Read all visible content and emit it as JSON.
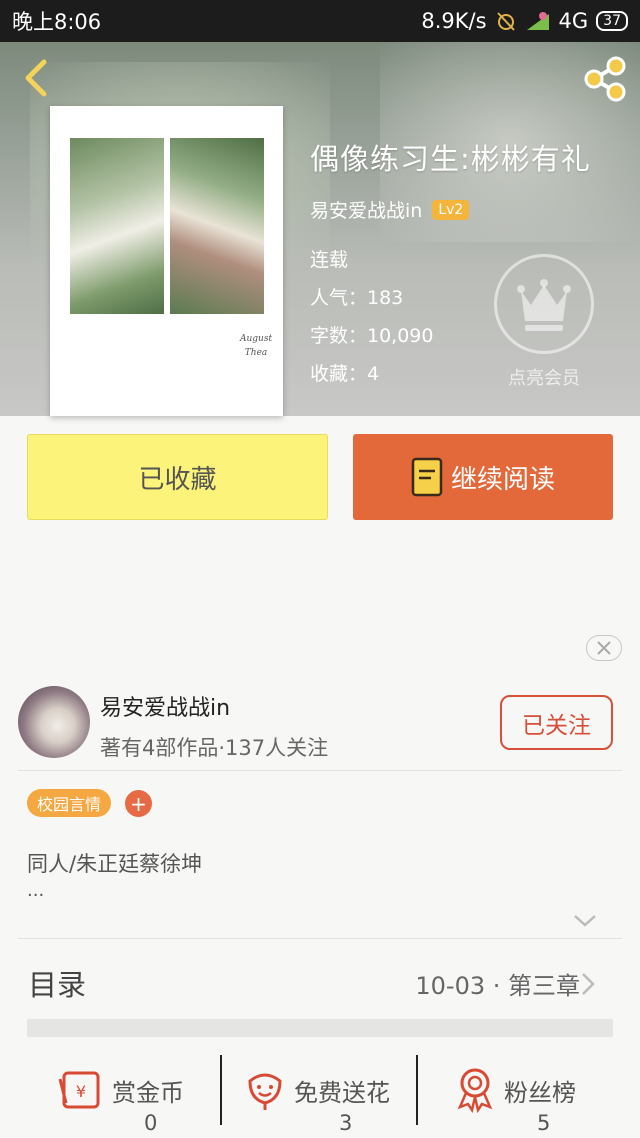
{
  "status_bar": {
    "time": "晚上8:06",
    "speed": "8.9K/s",
    "network": "4G",
    "battery": "37"
  },
  "book": {
    "title": "偶像练习生:彬彬有礼",
    "author": "易安爱战战in",
    "author_level": "Lv2",
    "status": "连载",
    "popularity": "人气：183",
    "word_count": "字数：10,090",
    "favorites": "收藏：4",
    "cover_signature_line1": "August",
    "cover_signature_line2": "Thea"
  },
  "vip": {
    "label": "点亮会员",
    "icon": "crown-icon"
  },
  "actions": {
    "favorited_label": "已收藏",
    "continue_label": "继续阅读"
  },
  "author_card": {
    "name": "易安爱战战in",
    "stats": "著有4部作品·137人关注",
    "follow_label": "已关注"
  },
  "tags": {
    "items": [
      "校园言情"
    ],
    "add": "+"
  },
  "description": {
    "text": "同人/朱正廷蔡徐坤",
    "more": "..."
  },
  "toc": {
    "title": "目录",
    "latest": "10-03 · 第三章"
  },
  "footer": {
    "items": [
      {
        "label": "赏金币",
        "count": "0",
        "icon": "red-envelope-icon"
      },
      {
        "label": "免费送花",
        "count": "3",
        "icon": "flower-icon"
      },
      {
        "label": "粉丝榜",
        "count": "5",
        "icon": "medal-icon"
      }
    ]
  },
  "colors": {
    "accent_orange": "#e3683a",
    "favorited_yellow": "#fcf47a",
    "follow_red": "#d7503a",
    "tag_orange": "#f5a841",
    "icon_red": "#d94a35",
    "level_badge": "#f5b43a"
  }
}
